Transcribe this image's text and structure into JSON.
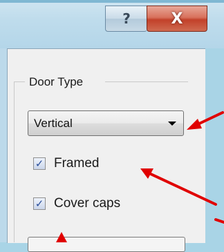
{
  "window": {
    "help_button_label": "?",
    "close_button_label": "X"
  },
  "group": {
    "label": "Door Type"
  },
  "dropdown": {
    "selected_value": "Vertical"
  },
  "checkboxes": [
    {
      "label": "Framed",
      "checked": true
    },
    {
      "label": "Cover caps",
      "checked": true
    }
  ],
  "icons": {
    "help": "help-icon",
    "close": "close-icon",
    "dropdown_arrow": "chevron-down-icon",
    "check": "checkmark-icon",
    "annotation": "red-arrow-icon"
  },
  "colors": {
    "annotation_arrow": "#e00000",
    "close_button": "#c2412a",
    "checkmark": "#2a4e9a"
  }
}
